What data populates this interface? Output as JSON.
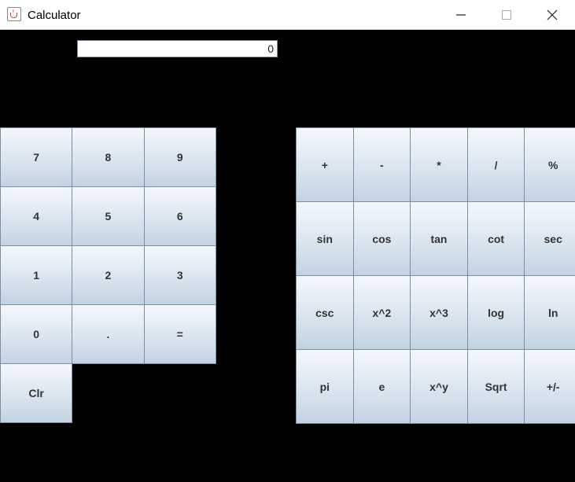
{
  "window": {
    "title": "Calculator",
    "controls": [
      "minimize",
      "maximize",
      "close"
    ]
  },
  "display": {
    "value": "0"
  },
  "numpad": {
    "rows": [
      [
        "7",
        "8",
        "9"
      ],
      [
        "4",
        "5",
        "6"
      ],
      [
        "1",
        "2",
        "3"
      ],
      [
        "0",
        ".",
        "="
      ],
      [
        "Clr"
      ]
    ]
  },
  "functions": {
    "rows": [
      [
        "+",
        "-",
        "*",
        "/",
        "%"
      ],
      [
        "sin",
        "cos",
        "tan",
        "cot",
        "sec"
      ],
      [
        "csc",
        "x^2",
        "x^3",
        "log",
        "ln"
      ],
      [
        "pi",
        "e",
        "x^y",
        "Sqrt",
        "+/-"
      ]
    ]
  },
  "colors": {
    "background": "#000000",
    "button_top": "#f4f8fc",
    "button_bottom": "#c3d3e3",
    "button_border": "#7b8ea3"
  }
}
